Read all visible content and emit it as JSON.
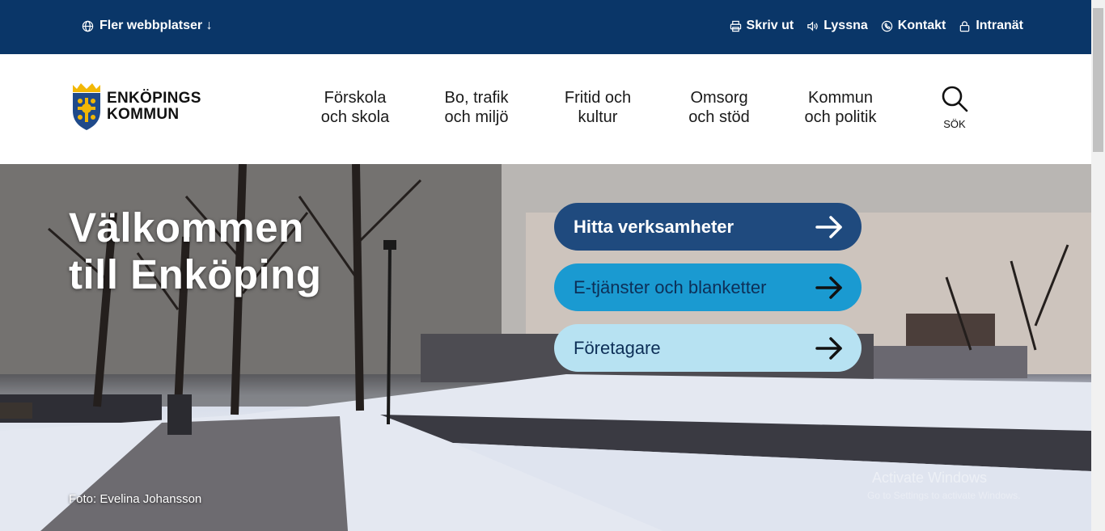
{
  "topbar": {
    "more_sites": "Fler webbplatser ↓",
    "links": [
      {
        "label": "Skriv ut",
        "icon": "printer-icon"
      },
      {
        "label": "Lyssna",
        "icon": "speaker-icon"
      },
      {
        "label": "Kontakt",
        "icon": "phone-icon"
      },
      {
        "label": "Intranät",
        "icon": "lock-icon"
      }
    ]
  },
  "logo": {
    "line1": "ENKÖPINGS",
    "line2": "KOMMUN"
  },
  "nav": [
    {
      "line1": "Förskola",
      "line2": "och skola"
    },
    {
      "line1": "Bo, trafik",
      "line2": "och miljö"
    },
    {
      "line1": "Fritid och",
      "line2": "kultur"
    },
    {
      "line1": "Omsorg",
      "line2": "och stöd"
    },
    {
      "line1": "Kommun",
      "line2": "och politik"
    }
  ],
  "search": {
    "label": "SÖK"
  },
  "hero": {
    "title_line1": "Välkommen",
    "title_line2": "till Enköping",
    "photo_credit": "Foto: Evelina Johansson",
    "buttons": [
      {
        "label": "Hitta verksamheter"
      },
      {
        "label": "E-tjänster och blanketter"
      },
      {
        "label": "Företagare"
      }
    ],
    "watermark_line1": "Activate Windows",
    "watermark_line2": "Go to Settings to activate Windows."
  },
  "colors": {
    "topbar": "#0a3668",
    "cta1": "#1f4a7e",
    "cta2": "#1a9ad1",
    "cta3": "#b7e2f2"
  }
}
